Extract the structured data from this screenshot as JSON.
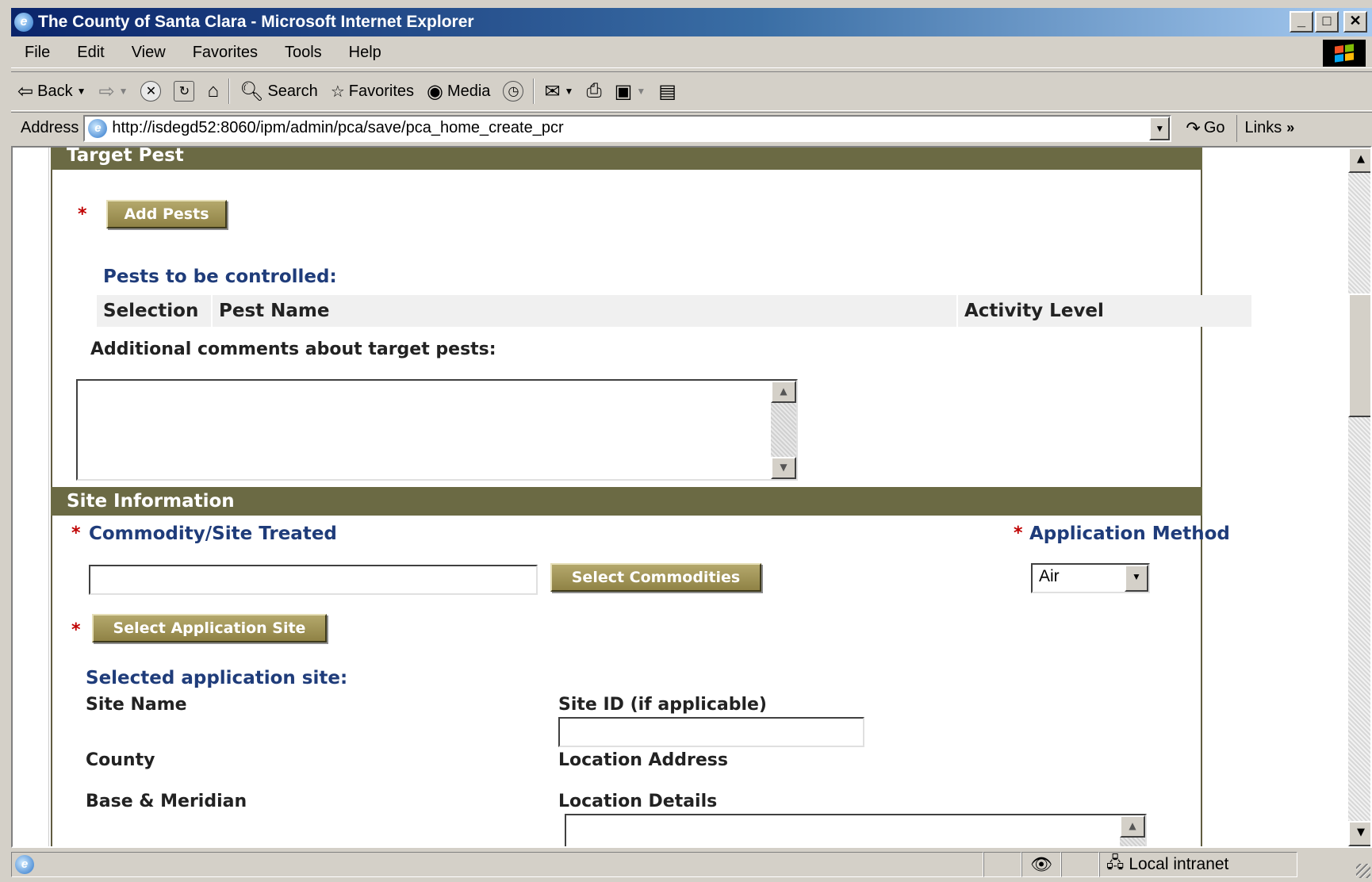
{
  "window": {
    "title": "The County of Santa Clara - Microsoft Internet Explorer",
    "min": "_",
    "max": "□",
    "close": "✕"
  },
  "menu": [
    "File",
    "Edit",
    "View",
    "Favorites",
    "Tools",
    "Help"
  ],
  "toolbar": {
    "back": "Back",
    "search": "Search",
    "favorites": "Favorites",
    "media": "Media"
  },
  "address": {
    "label": "Address",
    "url": "http://isdegd52:8060/ipm/admin/pca/save/pca_home_create_pcr",
    "go": "Go",
    "links": "Links"
  },
  "target_pest": {
    "header": "Target Pest",
    "required_mark": "*",
    "add_pests_button": "Add Pests",
    "pests_label": "Pests to be controlled:",
    "columns": [
      "Selection",
      "Pest Name",
      "Activity Level"
    ],
    "comments_label": "Additional comments about target pests:",
    "comments_value": ""
  },
  "site_info": {
    "header": "Site Information",
    "required_mark": "*",
    "commodity_label": "Commodity/Site Treated",
    "commodity_value": "",
    "select_commodities_button": "Select Commodities",
    "application_method_label": "Application Method",
    "application_method_value": "Air",
    "select_site_button": "Select Application Site",
    "selected_site_label": "Selected application site:",
    "site_name_label": "Site Name",
    "site_id_label": "Site ID (if applicable)",
    "site_id_value": "",
    "county_label": "County",
    "location_address_label": "Location Address",
    "base_meridian_label": "Base & Meridian",
    "location_details_label": "Location Details"
  },
  "status": {
    "zone": "Local intranet"
  },
  "colors": {
    "section_header": "#6b6a44",
    "button": "#9a8d50",
    "label_blue": "#1f3c7a",
    "required": "#c00000"
  }
}
